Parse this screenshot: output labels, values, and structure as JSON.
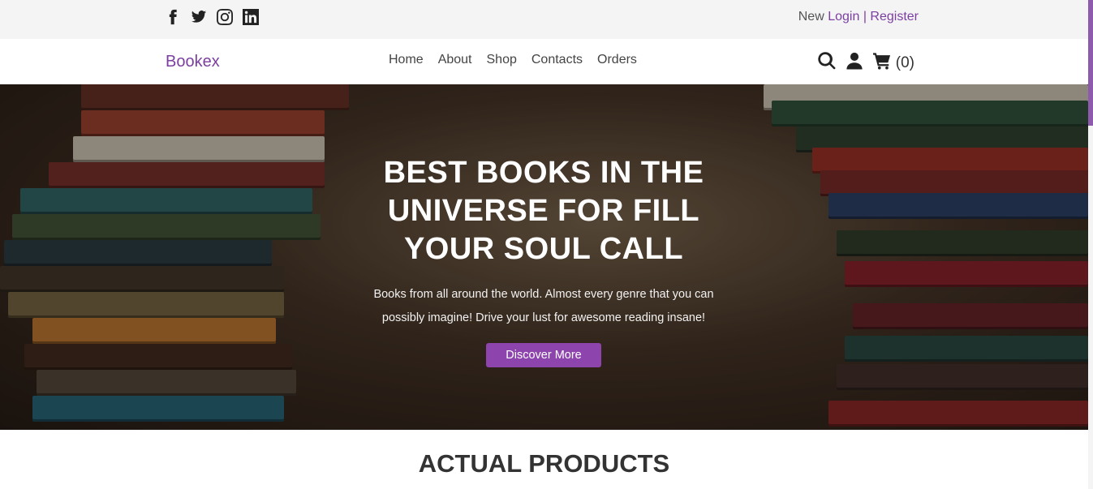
{
  "topbar": {
    "social": [
      "facebook-icon",
      "twitter-icon",
      "instagram-icon",
      "linkedin-icon"
    ],
    "auth_prefix": "New",
    "login_label": "Login",
    "separator": "|",
    "register_label": "Register"
  },
  "navbar": {
    "brand": "Bookex",
    "menu": [
      "Home",
      "About",
      "Shop",
      "Contacts",
      "Orders"
    ],
    "cart_count": "(0)"
  },
  "hero": {
    "title": "BEST BOOKS IN THE UNIVERSE FOR FILL YOUR SOUL CALL",
    "subtitle": "Books from all around the world. Almost every genre that you can possibly imagine! Drive your lust for awesome reading insane!",
    "button_label": "Discover More"
  },
  "products": {
    "title": "ACTUAL PRODUCTS"
  },
  "colors": {
    "accent": "#8e44ad",
    "link": "#7b3fa0",
    "topbar_bg": "#f4f4f4"
  }
}
